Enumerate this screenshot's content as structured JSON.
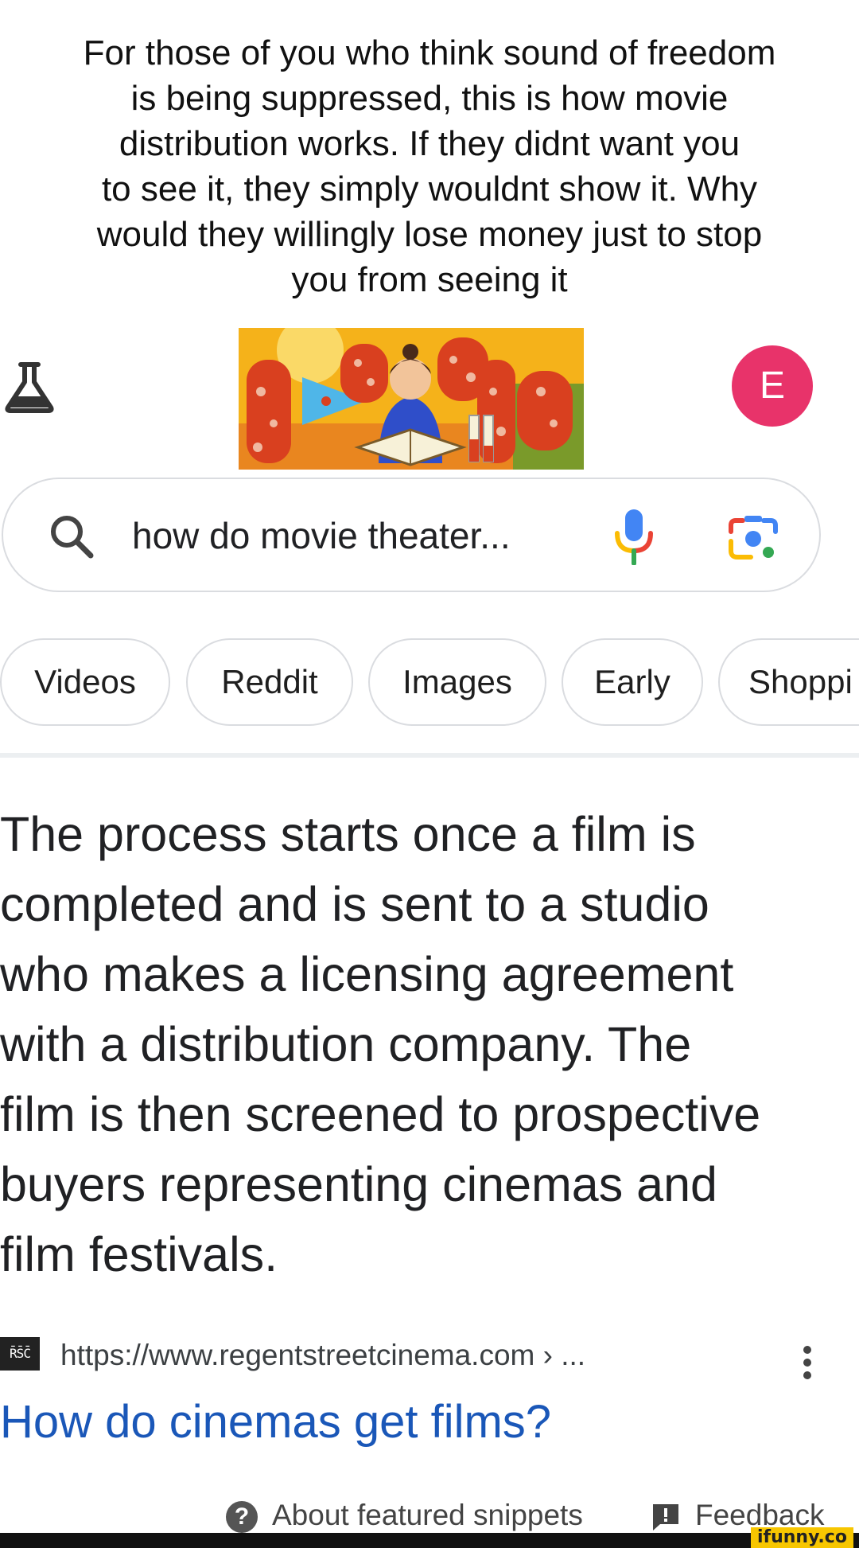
{
  "caption": {
    "lines": [
      "For those of you who think sound of freedom",
      "is being suppressed, this is how movie",
      "distribution works. If they didnt want you",
      "to see it, they simply wouldnt show it. Why",
      "would they willingly lose money just to stop",
      "you from seeing it"
    ]
  },
  "header": {
    "labs_icon": "flask-icon",
    "doodle_logo_alt": "Google Doodle",
    "avatar_letter": "E",
    "avatar_color": "#e8336a"
  },
  "search": {
    "query": "how do movie theater...",
    "search_icon": "search-icon",
    "mic_icon": "mic-icon",
    "lens_icon": "lens-camera-icon"
  },
  "chips": [
    {
      "label": "Videos"
    },
    {
      "label": "Reddit"
    },
    {
      "label": "Images"
    },
    {
      "label": "Early"
    },
    {
      "label": "Shoppi"
    }
  ],
  "snippet": {
    "lines": [
      "The process starts once a film is",
      "completed and is sent to a studio",
      "who makes a licensing agreement",
      "with a distribution company. The",
      "film is then screened to prospective",
      "buyers representing cinemas and",
      "film festivals."
    ]
  },
  "source": {
    "favicon_text": "R̄S̄C̄",
    "url": "https://www.regentstreetcinema.com › ...",
    "more_icon": "more-vert-icon"
  },
  "result": {
    "title": "How do cinemas get films?"
  },
  "footer": {
    "about_label": "About featured snippets",
    "feedback_label": "Feedback"
  },
  "watermark": {
    "text": "ifunny.co"
  },
  "colors": {
    "link_blue": "#1a57b8",
    "chip_border": "#dadce0",
    "text_dark": "#202124"
  }
}
